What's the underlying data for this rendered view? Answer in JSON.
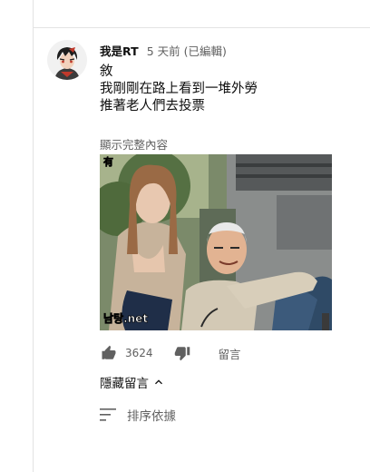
{
  "comment": {
    "author": "我是RT",
    "meta": "5 天前 (已編輯)",
    "lines": [
      "敘",
      "我剛剛在路上看到一堆外勞",
      "推著老人們去投票"
    ],
    "show_more_label": "顯示完整內容",
    "media": {
      "watermark_text": "남탕.net",
      "corner_text": "有"
    },
    "like_count": "3624",
    "reply_label": "留言",
    "hide_replies_label": "隱藏留言",
    "sort_label": "排序依據"
  },
  "colors": {
    "text_primary": "#0f0f0f",
    "text_secondary": "#606060",
    "divider": "#e3e3e3"
  },
  "icons": {
    "like": "thumbs-up-icon",
    "dislike": "thumbs-down-icon",
    "collapse": "chevron-up-icon",
    "sort": "sort-lines-icon"
  }
}
